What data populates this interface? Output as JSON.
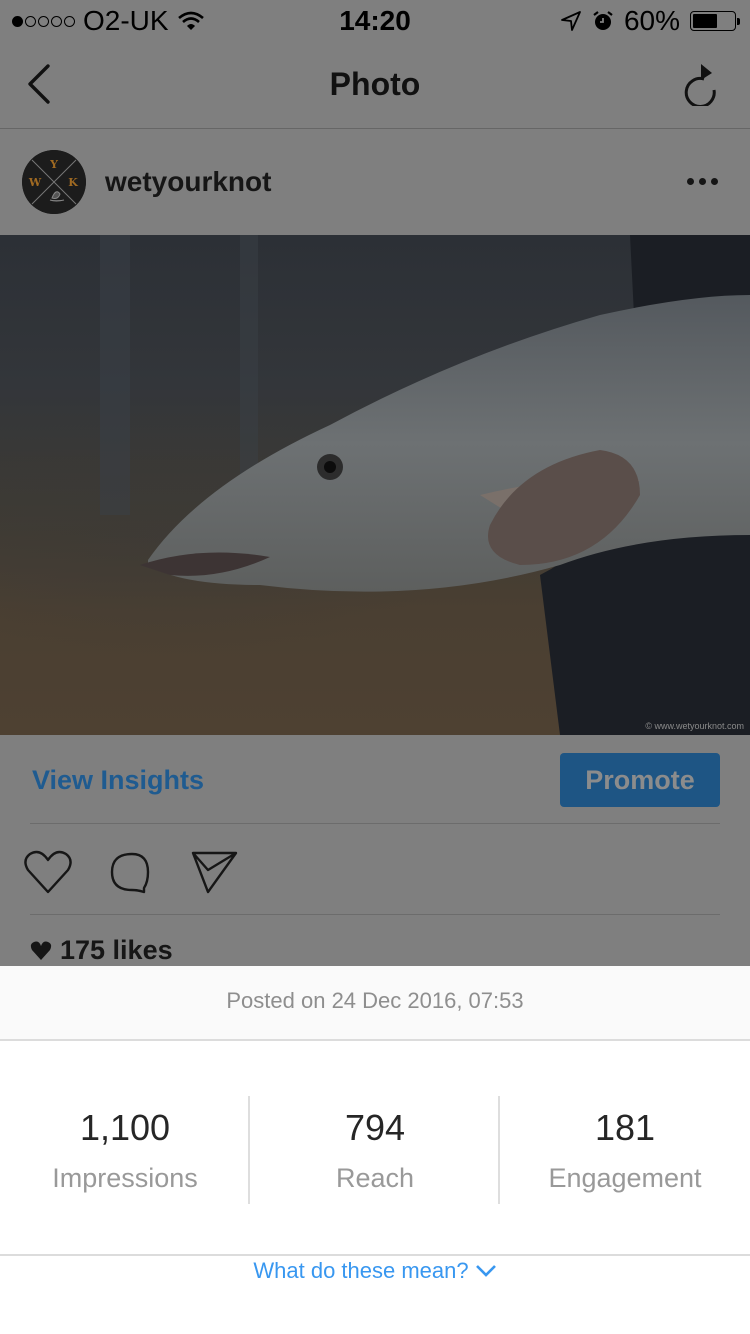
{
  "status_bar": {
    "signal_strength": "1 of 5",
    "carrier": "O2-UK",
    "time": "14:20",
    "battery_percent": "60%",
    "battery_level": 0.6,
    "icons": [
      "signal-dots-icon",
      "wifi-icon",
      "location-arrow-icon",
      "alarm-icon",
      "battery-icon"
    ]
  },
  "nav": {
    "title": "Photo",
    "back_icon": "chevron-left-icon",
    "refresh_icon": "refresh-icon"
  },
  "post": {
    "username": "wetyourknot",
    "avatar_letters": {
      "top": "Y",
      "left": "W",
      "right": "K"
    },
    "more_icon": "ellipsis-icon",
    "watermark": "© www.wetyourknot.com",
    "view_insights_label": "View Insights",
    "promote_label": "Promote",
    "action_icons": [
      "heart-icon",
      "comment-icon",
      "send-icon"
    ],
    "likes": "175 likes"
  },
  "insights": {
    "posted": "Posted on 24 Dec 2016, 07:53",
    "stats": [
      {
        "value": "1,100",
        "label": "Impressions"
      },
      {
        "value": "794",
        "label": "Reach"
      },
      {
        "value": "181",
        "label": "Engagement"
      }
    ],
    "help_link": "What do these mean?",
    "colors": {
      "link": "#3897f0",
      "muted": "#999999"
    }
  }
}
